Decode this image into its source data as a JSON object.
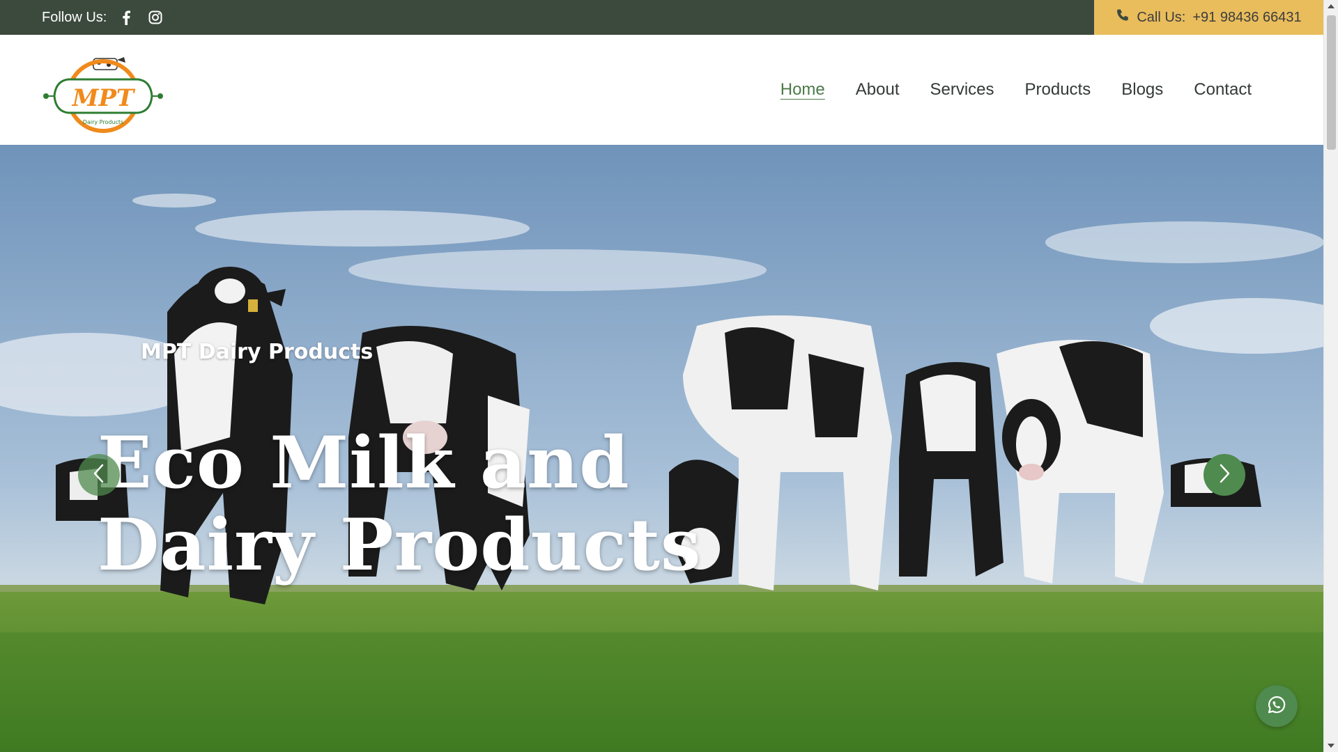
{
  "topbar": {
    "follow_label": "Follow Us:",
    "social_icons": [
      "facebook-icon",
      "instagram-icon"
    ],
    "call_label": "Call Us:",
    "phone": "+91 98436 66431"
  },
  "logo": {
    "text": "MPT",
    "tagline": "Dairy Products"
  },
  "nav": {
    "items": [
      {
        "label": "Home",
        "active": true
      },
      {
        "label": "About",
        "active": false
      },
      {
        "label": "Services",
        "active": false
      },
      {
        "label": "Products",
        "active": false
      },
      {
        "label": "Blogs",
        "active": false
      },
      {
        "label": "Contact",
        "active": false
      }
    ]
  },
  "hero": {
    "subtitle": "MPT Dairy Products",
    "title": "Eco Milk and Dairy Products"
  },
  "colors": {
    "topbar_bg": "#3c4a3e",
    "call_bg": "#e9bd5c",
    "accent_green": "#4f8a4e",
    "logo_orange": "#f08a1c"
  }
}
